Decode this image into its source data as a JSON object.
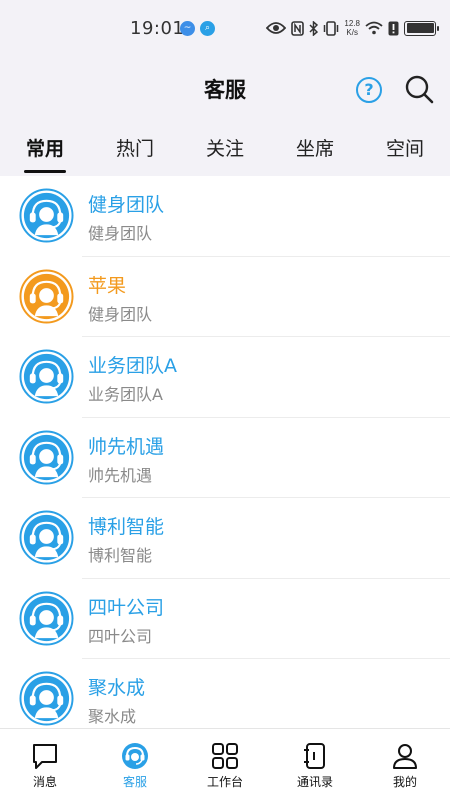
{
  "status_bar": {
    "time": "19:01",
    "net_speed_value": "12.8",
    "net_speed_unit": "K/s",
    "icons": [
      "eye-icon",
      "nfc-icon",
      "bluetooth-icon",
      "vibrate-icon",
      "wifi-icon",
      "alert-icon",
      "battery-charging-icon"
    ]
  },
  "header": {
    "title": "客服",
    "help_label": "?"
  },
  "tabs": [
    {
      "label": "常用",
      "active": true
    },
    {
      "label": "热门",
      "active": false
    },
    {
      "label": "关注",
      "active": false
    },
    {
      "label": "坐席",
      "active": false
    },
    {
      "label": "空间",
      "active": false
    }
  ],
  "contacts": [
    {
      "name": "健身团队",
      "subtitle": "健身团队",
      "color": "#2aa0e6"
    },
    {
      "name": "苹果",
      "subtitle": "健身团队",
      "color": "#f39a1e"
    },
    {
      "name": "业务团队A",
      "subtitle": "业务团队A",
      "color": "#2aa0e6"
    },
    {
      "name": "帅先机遇",
      "subtitle": "帅先机遇",
      "color": "#2aa0e6"
    },
    {
      "name": "博利智能",
      "subtitle": "博利智能",
      "color": "#2aa0e6"
    },
    {
      "name": "四叶公司",
      "subtitle": "四叶公司",
      "color": "#2aa0e6"
    },
    {
      "name": "聚水成",
      "subtitle": "聚水成",
      "color": "#2aa0e6"
    }
  ],
  "bottom_nav": [
    {
      "label": "消息",
      "icon": "message-icon",
      "active": false
    },
    {
      "label": "客服",
      "icon": "customer-service-icon",
      "active": true
    },
    {
      "label": "工作台",
      "icon": "workbench-icon",
      "active": false
    },
    {
      "label": "通讯录",
      "icon": "address-book-icon",
      "active": false
    },
    {
      "label": "我的",
      "icon": "profile-icon",
      "active": false
    }
  ],
  "colors": {
    "accent": "#2aa0e6",
    "orange": "#f39a1e",
    "header_bg": "#f3f2f7"
  }
}
